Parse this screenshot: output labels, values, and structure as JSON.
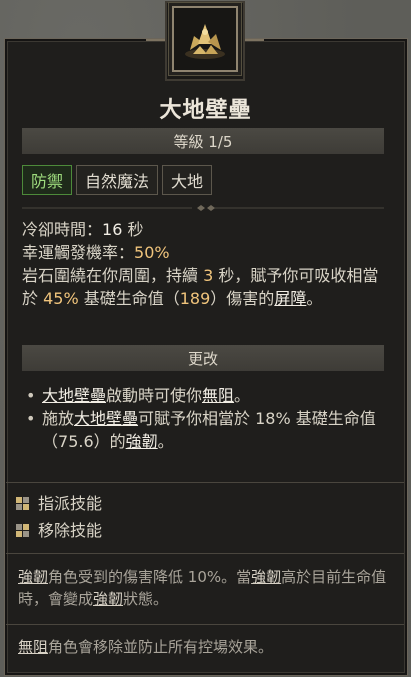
{
  "skill": {
    "name": "大地壁壘",
    "rank": "等級 1/5",
    "icon": "earthen-bulwark-icon",
    "tags": [
      {
        "label": "防禦",
        "active": true
      },
      {
        "label": "自然魔法",
        "active": false
      },
      {
        "label": "大地",
        "active": false
      }
    ]
  },
  "stats": {
    "cooldown_label": "冷卻時間：",
    "cooldown_value": "16",
    "cooldown_unit": " 秒",
    "lucky_label": "幸運觸發機率：",
    "lucky_value": "50%",
    "desc_1": "岩石圍繞在你周圍，持續 ",
    "desc_duration": "3",
    "desc_2": " 秒，賦予你可吸收相當於 ",
    "desc_percent": "45%",
    "desc_3": " 基礎生命值（",
    "desc_value": "189",
    "desc_4": "）傷害的",
    "desc_barrier": "屏障",
    "desc_5": "。"
  },
  "modifications": {
    "header": "更改",
    "bullet_1_a": "大地壁壘",
    "bullet_1_b": "啟動時可使你",
    "bullet_1_c": "無阻",
    "bullet_1_d": "。",
    "bullet_2_a": "施放",
    "bullet_2_b": "大地壁壘",
    "bullet_2_c": "可賦予你相當於 ",
    "bullet_2_d": "18%",
    "bullet_2_e": " 基礎生命值（",
    "bullet_2_f": "75.6",
    "bullet_2_g": "）的",
    "bullet_2_h": "強韌",
    "bullet_2_i": "。"
  },
  "actions": [
    {
      "label": "指派技能"
    },
    {
      "label": "移除技能"
    }
  ],
  "glossary": {
    "fortify_term": "強韌",
    "fortify_1": "角色受到的傷害降低 10%。當",
    "fortify_term2": "強韌",
    "fortify_2": "高於目前生命值時，會變成",
    "fortify_term3": "強韌",
    "fortify_3": "狀態。",
    "unstoppable_term": "無阻",
    "unstoppable_1": "角色會移除並防止所有控場效果。"
  },
  "colors": {
    "accent": "#f0c47c",
    "tag_active": "#9fdc7e"
  }
}
